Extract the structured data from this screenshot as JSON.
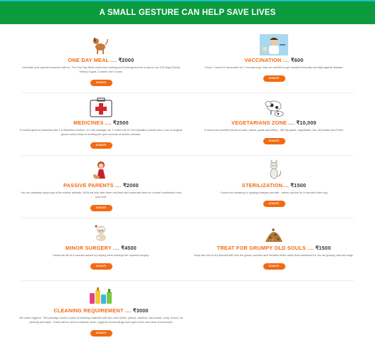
{
  "header": {
    "title": "A SMALL GESTURE CAN HELP SAVE LIVES"
  },
  "colors": {
    "banner": "#0c9a3e",
    "accent": "#f26a12",
    "button": "#f26a12"
  },
  "cards": [
    {
      "icon": "dog-icon",
      "name": "ONE DAY MEAL ....",
      "price": "₹2000",
      "desc": "Celebrate your special moments with us. The One Day Meal covers the morning and evening food for a day for our 152 dogs (Purely Sheep) 5 goat, 3 calves and 3 cows.",
      "button": "DONATE"
    },
    {
      "icon": "vaccination-icon",
      "name": "VACCINATION ....",
      "price": "₹600",
      "desc": "Cover 1 round of vaccination for 1 rescued dog, help our scientist to get boosted immunity and fight against disease.",
      "button": "DONATE"
    },
    {
      "icon": "medical-kit-icon",
      "name": "MEDICINES ....",
      "price": "₹2500",
      "desc": "It consist general medicines like 1 ltr Betadine solution, 10 rolls bandage roll, 1 cotton roll,10 roll Capsaline powder and 1 box of surgical gloves which helps in treating the open wounds of shelter animals.",
      "button": "DONATE"
    },
    {
      "icon": "cow-icon",
      "name": "VEGETARIANS ZONE ....",
      "price": "₹10,000",
      "desc": "It covers the monthly needs of cows, calves, goats and sheep - like dry grass, vegetables, mix, dry fodder and Fruits.",
      "button": "DONATE"
    },
    {
      "icon": "girl-with-dog-icon",
      "name": "PASSIVE PARENTS ....",
      "price": "₹2000",
      "desc": "You can passively adopt any of the shelter animals. WGA will look after them and feed and vaccinate them for a small contribution from your end.",
      "button": "DONATE"
    },
    {
      "icon": "cat-icon",
      "name": "STERILIZATION....",
      "price": "₹1500",
      "desc": "Covers the neutering or spaying charges and anti - rabies vaccine for a rescued Indie dog.",
      "button": "DONATE"
    },
    {
      "icon": "injured-dog-icon",
      "name": "MINOR SURGERY ....",
      "price": "₹4500",
      "desc": "Saves the life of a rescued animal by helping them undergo the required surgery.",
      "button": "DONATE"
    },
    {
      "icon": "biscuit-pile-icon",
      "name": "TREAT FOR GRUMPY OLD SOULS ....",
      "price": "₹1500",
      "desc": "Buys two Kilo of dry Biscuits with Ash the goose pouches and Geriatric which helps feed medicines for our old grumpy cats and dogs.",
      "button": "DONATE"
    },
    {
      "icon": "cleaning-supplies-icon",
      "name": "CLEANING REQUIREMENT ....",
      "price": "₹3000",
      "desc": "We value Hygiene. This package covers a pack of cleaning materials with two cans Dettol, phenyl, sanitizer, hand wash, soap, broom, tin cleaning and wiper. These will be used to maintain clean, hygienic surroundings and a germ-free and clean environment.",
      "button": "DONATE"
    }
  ]
}
